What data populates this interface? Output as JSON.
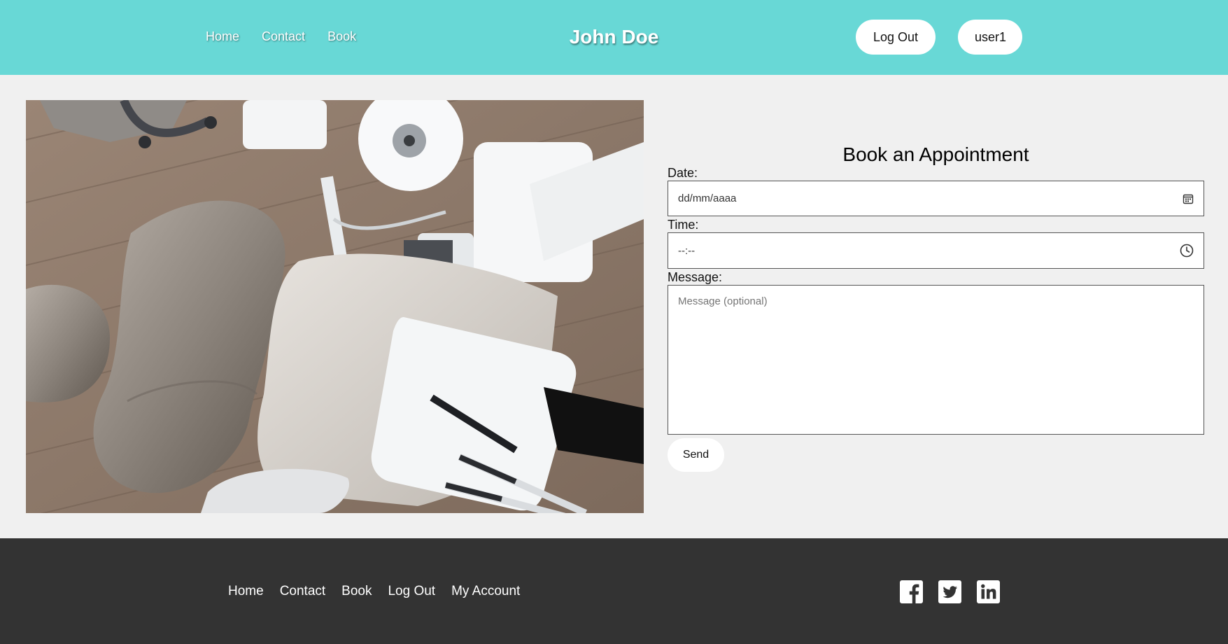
{
  "header": {
    "nav": [
      "Home",
      "Contact",
      "Book"
    ],
    "brand": "John Doe",
    "logout_label": "Log Out",
    "user_label": "user1"
  },
  "photo": {
    "subject": "dental-chair-top-view",
    "icon": "dental-office-photo"
  },
  "form": {
    "title": "Book an Appointment",
    "date_label": "Date:",
    "date_value": "dd/mm/aaaa",
    "time_label": "Time:",
    "time_value": "--:--",
    "message_label": "Message:",
    "message_placeholder": "Message (optional)",
    "send_label": "Send",
    "icons": {
      "date": "calendar-icon",
      "time": "clock-icon"
    }
  },
  "footer": {
    "nav": [
      "Home",
      "Contact",
      "Book",
      "Log Out",
      "My Account"
    ],
    "social": [
      "facebook-icon",
      "twitter-icon",
      "linkedin-icon"
    ]
  },
  "colors": {
    "header_bg": "#68d8d6",
    "page_bg": "#f0f0f0",
    "footer_bg": "#333333",
    "button_bg": "#ffffff"
  }
}
